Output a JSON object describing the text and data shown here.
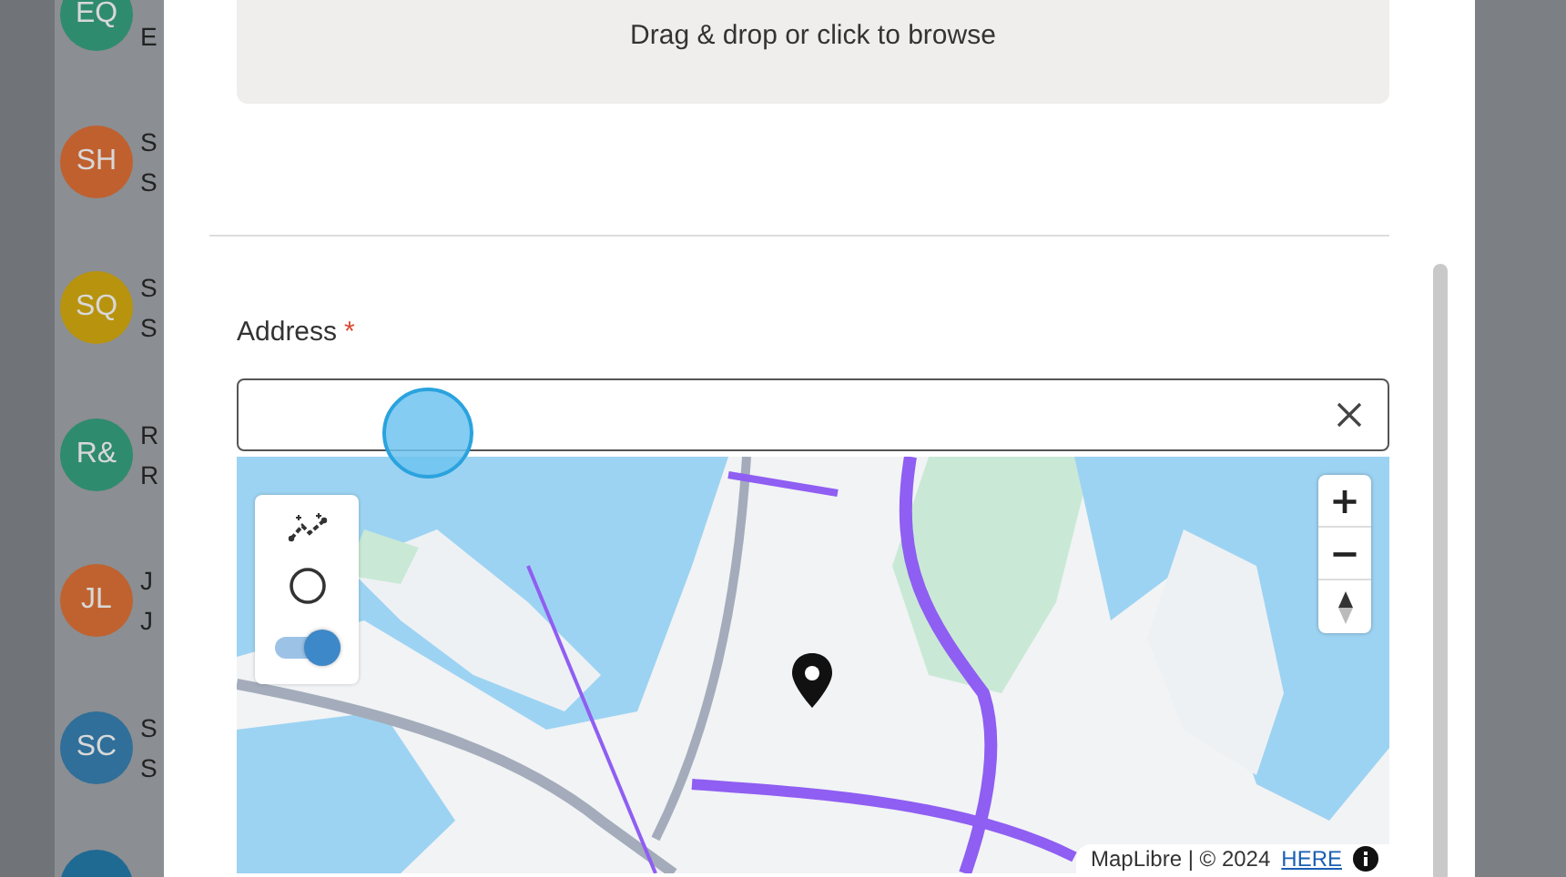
{
  "contacts": [
    {
      "initials": "EQ",
      "color": "#2f8b6e",
      "subtitle": "E"
    },
    {
      "initials": "SH",
      "color": "#c0602f",
      "name": "S",
      "subtitle": "S"
    },
    {
      "initials": "SQ",
      "color": "#b8930e",
      "name": "S",
      "subtitle": "S"
    },
    {
      "initials": "R&",
      "color": "#2f8b6e",
      "name": "R",
      "subtitle": "R"
    },
    {
      "initials": "JL",
      "color": "#c0622f",
      "name": "J",
      "subtitle": "J"
    },
    {
      "initials": "SC",
      "color": "#2f6f99",
      "name": "S",
      "subtitle": "S"
    }
  ],
  "upload": {
    "prompt": "Drag & drop or click to browse"
  },
  "address": {
    "label": "Address",
    "required_mark": "*"
  },
  "map": {
    "kind": "picture",
    "draw_tools": [
      {
        "kind": "polyline"
      },
      {
        "kind": "circle"
      },
      {
        "kind": "toggle",
        "on": true
      }
    ],
    "zoom_in": "+",
    "zoom_out": "−",
    "attribution": "MapLibre | © 2024",
    "attribution_link": "HERE"
  }
}
